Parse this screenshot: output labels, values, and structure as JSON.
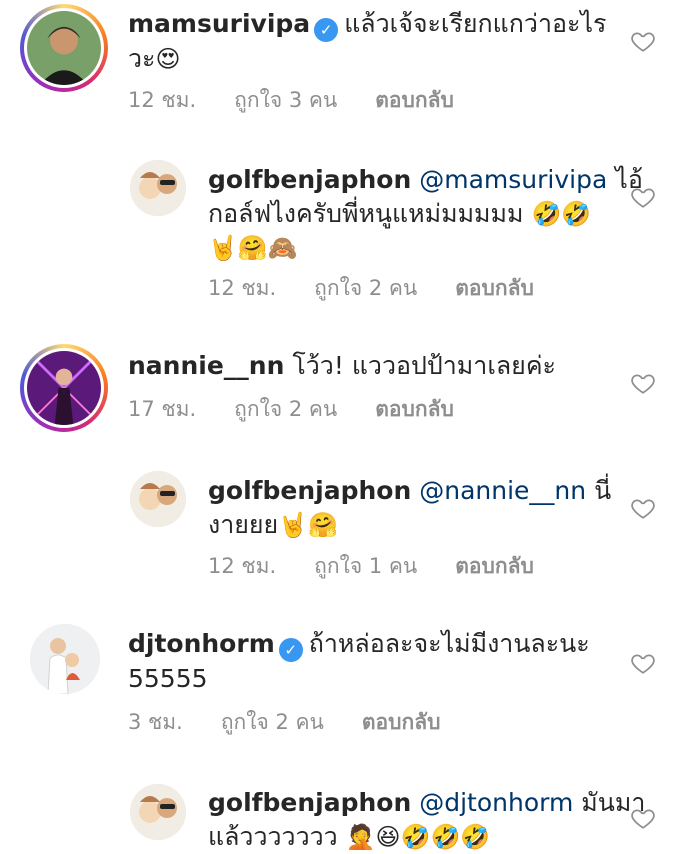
{
  "comments": [
    {
      "username": "mamsurivipa",
      "verified": true,
      "text_line1": "แล้วเจ้จะเรียกแกว่าอะไร",
      "text_line2": "วะ",
      "emoji_line2": "😍",
      "time": "12 ชม.",
      "likes": "ถูกใจ 3 คน",
      "reply": "ตอบกลับ"
    },
    {
      "username": "golfbenjaphon",
      "mention": "@mamsurivipa",
      "text_tail": "ไอ้",
      "text_line2": "กอล์ฟไงครับพี่หนูแหม่มมมมม",
      "emoji_line2": "🤣🤣",
      "emoji_line3": "🤘🤗🙈",
      "time": "12 ชม.",
      "likes": "ถูกใจ 2 คน",
      "reply": "ตอบกลับ"
    },
    {
      "username": "nannie__nn",
      "text_line1": "โว้ว! แววอปป้ามาเลยค่ะ",
      "time": "17 ชม.",
      "likes": "ถูกใจ 2 คน",
      "reply": "ตอบกลับ"
    },
    {
      "username": "golfbenjaphon",
      "mention": "@nannie__nn",
      "text_tail": "นี่",
      "text_line2": "งายยย",
      "emoji_line2": "🤘🤗",
      "time": "12 ชม.",
      "likes": "ถูกใจ 1 คน",
      "reply": "ตอบกลับ"
    },
    {
      "username": "djtonhorm",
      "verified": true,
      "text_line1": "ถ้าหล่อละจะไม่มีงานละนะ",
      "text_line2": "55555",
      "time": "3 ชม.",
      "likes": "ถูกใจ 2 คน",
      "reply": "ตอบกลับ"
    },
    {
      "username": "golfbenjaphon",
      "mention": "@djtonhorm",
      "text_tail": "มันมา",
      "text_line2": "แล้ววววววว",
      "emoji_line2": "🤦😆🤣🤣🤣"
    }
  ],
  "icons": {
    "verified": "verified-badge-icon",
    "like": "heart-outline-icon"
  },
  "colors": {
    "verified": "#3897f0",
    "mention": "#003569",
    "meta": "#8e8e8e",
    "text": "#262626"
  }
}
